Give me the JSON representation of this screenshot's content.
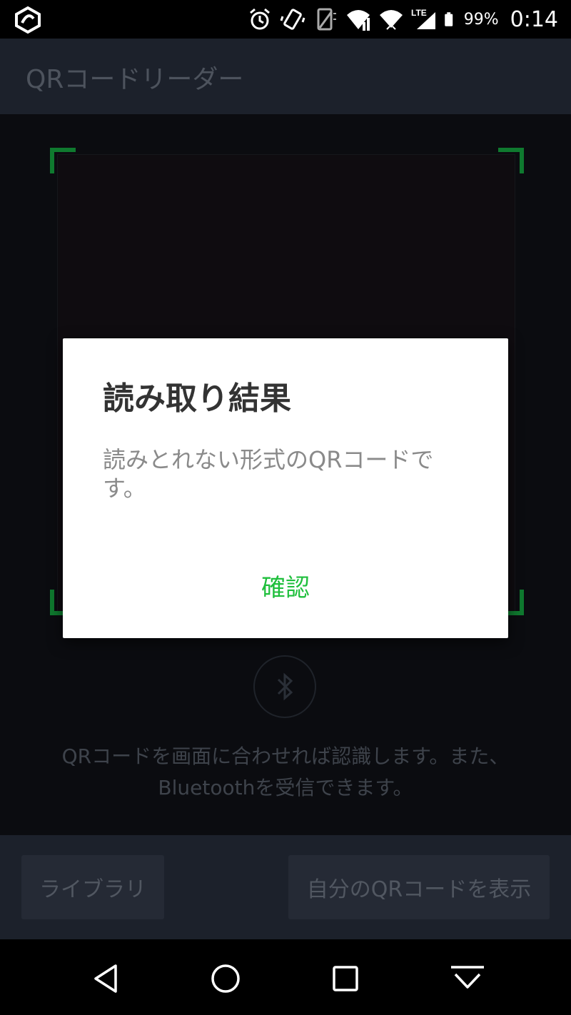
{
  "status_bar": {
    "battery_percent": "99%",
    "time": "0:14",
    "network_label": "LTE"
  },
  "app_bar": {
    "title": "QRコードリーダー"
  },
  "camera": {
    "hint": "QRコードを画面に合わせれば認識します。また、Bluetoothを受信できます。"
  },
  "bottom_bar": {
    "library_label": "ライブラリ",
    "my_qr_label": "自分のQRコードを表示"
  },
  "dialog": {
    "title": "読み取り結果",
    "message": "読みとれない形式のQRコードです。",
    "confirm_label": "確認"
  },
  "colors": {
    "accent_green": "#1fbf3c",
    "frame_green": "#0f7a2f",
    "bar_bg": "#1c212b"
  }
}
